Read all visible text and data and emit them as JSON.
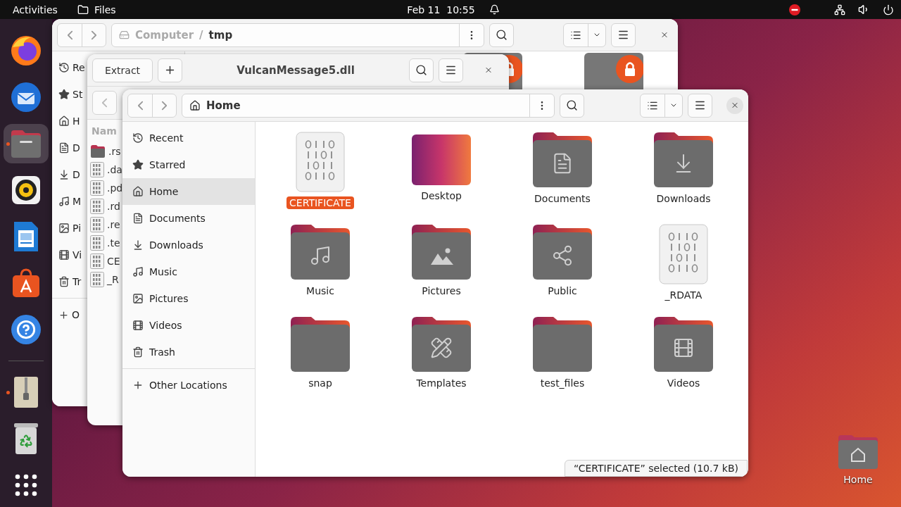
{
  "top_bar": {
    "activities": "Activities",
    "app": "Files",
    "clock": "Feb 11  10:55"
  },
  "dock": [
    {
      "kind": "firefox",
      "selected": false,
      "running": false
    },
    {
      "kind": "thunderbird",
      "selected": false,
      "running": false
    },
    {
      "kind": "files",
      "selected": true,
      "running": true
    },
    {
      "kind": "rhythmbox",
      "selected": false,
      "running": false
    },
    {
      "kind": "writer",
      "selected": false,
      "running": false
    },
    {
      "kind": "appcenter",
      "selected": false,
      "running": false
    },
    {
      "kind": "help",
      "selected": false,
      "running": false
    },
    {
      "kind": "archive",
      "selected": false,
      "running": true
    },
    {
      "kind": "trash",
      "selected": false,
      "running": false
    },
    {
      "kind": "apps",
      "selected": false,
      "running": false
    }
  ],
  "back_window": {
    "path": [
      "Computer",
      "tmp"
    ],
    "separator": "/",
    "sidebar": [
      {
        "kind": "recent",
        "label": "Re"
      },
      {
        "kind": "starred",
        "label": "St"
      },
      {
        "kind": "home",
        "label": "H"
      },
      {
        "kind": "documents",
        "label": "D"
      },
      {
        "kind": "downloads",
        "label": "D"
      },
      {
        "kind": "music",
        "label": "M"
      },
      {
        "kind": "pictures",
        "label": "Pi"
      },
      {
        "kind": "videos",
        "label": "Vi"
      },
      {
        "kind": "trash",
        "label": "Tr"
      }
    ],
    "other": "O",
    "files": [
      {
        "kind": "locked"
      },
      {
        "kind": "locked"
      }
    ]
  },
  "archive_window": {
    "extract": "Extract",
    "title": "VulcanMessage5.dll",
    "column": "Nam",
    "files": [
      {
        "kind": "folder",
        "name": ".rs"
      },
      {
        "kind": "binary",
        "name": ".da"
      },
      {
        "kind": "binary",
        "name": ".pd"
      },
      {
        "kind": "binary",
        "name": ".rd"
      },
      {
        "kind": "binary",
        "name": ".re"
      },
      {
        "kind": "binary",
        "name": ".te"
      },
      {
        "kind": "binary",
        "name": "CE"
      },
      {
        "kind": "binary",
        "name": "_R"
      }
    ]
  },
  "front_window": {
    "path": "Home",
    "sidebar": [
      {
        "kind": "recent",
        "label": "Recent",
        "selected": false
      },
      {
        "kind": "starred",
        "label": "Starred",
        "selected": false
      },
      {
        "kind": "home",
        "label": "Home",
        "selected": true
      },
      {
        "kind": "documents",
        "label": "Documents",
        "selected": false
      },
      {
        "kind": "downloads",
        "label": "Downloads",
        "selected": false
      },
      {
        "kind": "music",
        "label": "Music",
        "selected": false
      },
      {
        "kind": "pictures",
        "label": "Pictures",
        "selected": false
      },
      {
        "kind": "videos",
        "label": "Videos",
        "selected": false
      },
      {
        "kind": "trash",
        "label": "Trash",
        "selected": false
      }
    ],
    "other": "Other Locations",
    "files": [
      {
        "kind": "binary",
        "name": "CERTIFICATE",
        "selected": true
      },
      {
        "kind": "desktop",
        "name": "Desktop",
        "selected": false
      },
      {
        "kind": "documents",
        "name": "Documents",
        "selected": false
      },
      {
        "kind": "downloads",
        "name": "Downloads",
        "selected": false
      },
      {
        "kind": "music",
        "name": "Music",
        "selected": false
      },
      {
        "kind": "pictures",
        "name": "Pictures",
        "selected": false
      },
      {
        "kind": "public",
        "name": "Public",
        "selected": false
      },
      {
        "kind": "binary",
        "name": "_RDATA",
        "selected": false
      },
      {
        "kind": "plain",
        "name": "snap",
        "selected": false
      },
      {
        "kind": "templates",
        "name": "Templates",
        "selected": false
      },
      {
        "kind": "plain",
        "name": "test_files",
        "selected": false
      },
      {
        "kind": "videos",
        "name": "Videos",
        "selected": false
      }
    ],
    "status": "“CERTIFICATE” selected (10.7 kB)"
  },
  "desktop_icons": [
    {
      "label": "Home"
    }
  ]
}
